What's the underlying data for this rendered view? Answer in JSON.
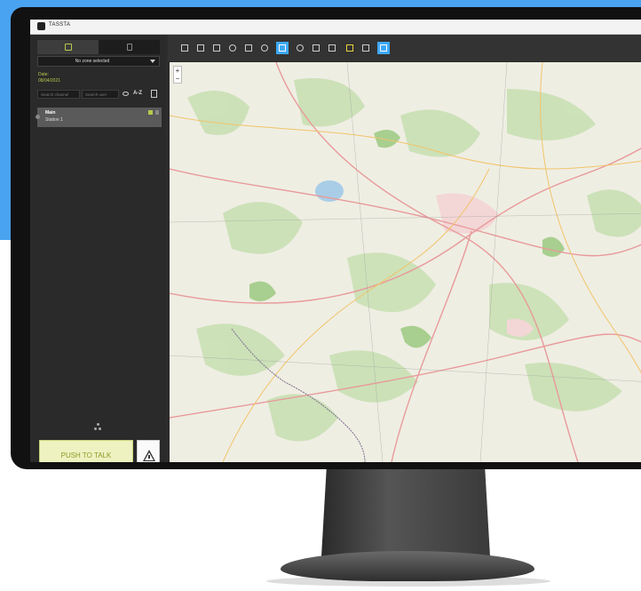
{
  "window": {
    "title": "TASSTA"
  },
  "left_panel": {
    "tabs": [
      {
        "icon": "box-icon",
        "active": true
      },
      {
        "icon": "radio-icon",
        "active": false
      }
    ],
    "zone_select": {
      "value": "No zone selected"
    },
    "date_label": "Date:",
    "date_value": "08/04/2021",
    "filters": {
      "search_placeholder": "Search channel",
      "second_placeholder": "Search user",
      "sort_label": "A-Z"
    },
    "list": [
      {
        "title": "Main",
        "subtitle": "Station 1"
      }
    ],
    "push_to_talk": "PUSH TO TALK"
  },
  "toolbar": {
    "tools": [
      {
        "icon": "mail-icon"
      },
      {
        "icon": "list-icon"
      },
      {
        "icon": "antenna-icon"
      },
      {
        "icon": "globe-icon"
      },
      {
        "icon": "users-icon"
      },
      {
        "icon": "power-icon"
      },
      {
        "icon": "fence-icon",
        "active": true
      },
      {
        "icon": "history-icon"
      },
      {
        "icon": "grid-icon"
      },
      {
        "icon": "home-icon"
      },
      {
        "icon": "layers-icon",
        "warn": true
      },
      {
        "icon": "map-layers-icon"
      },
      {
        "icon": "zoom-area-icon",
        "active": true
      }
    ]
  },
  "map": {
    "zoom_in": "+",
    "zoom_out": "−"
  },
  "colors": {
    "accent": "#3fa9f5",
    "ptt_bg": "#eef2c0",
    "brand_green": "#b9c94b"
  }
}
